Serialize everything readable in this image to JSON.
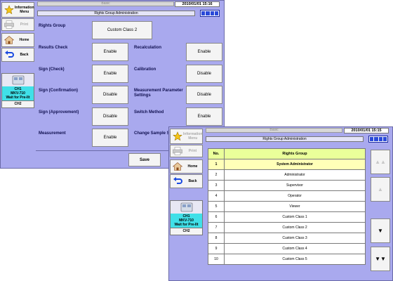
{
  "sidebar": {
    "info_label": "Information\nMenu",
    "print_label": "Print",
    "home_label": "Home",
    "back_label": "Back",
    "ch1_label": "CH1\nMKV-710\nWait for Pre-Ilt",
    "ch2_label": "CH2"
  },
  "screen1": {
    "topbar": "Basic",
    "clock": "2010/01/01 15:16",
    "title": "Rights Group Administration",
    "rights_group_label": "Rights Group",
    "rights_group_value": "Custom Class 2",
    "left_settings": [
      {
        "label": "Results Check",
        "value": "Enable"
      },
      {
        "label": "Sign (Check)",
        "value": "Enable"
      },
      {
        "label": "Sign (Confirmation)",
        "value": "Disable"
      },
      {
        "label": "Sign (Approvement)",
        "value": "Disable"
      },
      {
        "label": "Measurement",
        "value": "Enable"
      }
    ],
    "right_settings": [
      {
        "label": "Recalculation",
        "value": "Enable"
      },
      {
        "label": "Calibration",
        "value": "Disable"
      },
      {
        "label": "Measurement Parameter\nSettings",
        "value": "Disable"
      },
      {
        "label": "Switch Method",
        "value": "Enable"
      },
      {
        "label": "Change Sample S",
        "value": ""
      }
    ],
    "save_label": "Save"
  },
  "screen2": {
    "topbar": "Basic",
    "clock": "2010/01/01 15:15",
    "title": "Rights Group Administration",
    "table": {
      "headers": [
        "No.",
        "Rights Group"
      ],
      "rows": [
        [
          "1",
          "System Administrator"
        ],
        [
          "2",
          "Administrator"
        ],
        [
          "3",
          "Supervisor"
        ],
        [
          "4",
          "Operator"
        ],
        [
          "5",
          "Viewer"
        ],
        [
          "6",
          "Custom Class 1"
        ],
        [
          "7",
          "Custom Class 2"
        ],
        [
          "8",
          "Custom Class 3"
        ],
        [
          "9",
          "Custom Class 4"
        ],
        [
          "10",
          "Custom Class 5"
        ]
      ],
      "selected_row": 1
    },
    "page_buttons": {
      "first": "▲▲",
      "up": "▲",
      "down": "▼",
      "last": "▼▼"
    }
  },
  "colors": {
    "background": "#a9a9ee",
    "header_row": "#eaff9a",
    "selected_row": "#ffffb8",
    "channel_active": "#40e0e8"
  }
}
